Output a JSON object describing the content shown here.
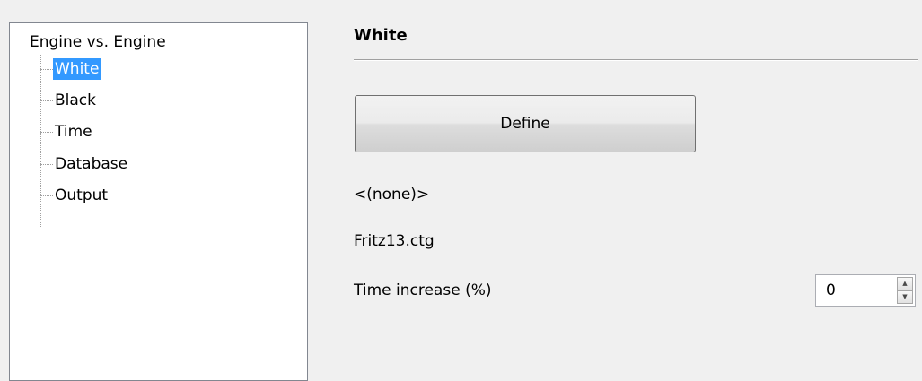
{
  "tree": {
    "root": "Engine vs. Engine",
    "items": [
      {
        "label": "White",
        "selected": true
      },
      {
        "label": "Black"
      },
      {
        "label": "Time"
      },
      {
        "label": "Database"
      },
      {
        "label": "Output"
      }
    ]
  },
  "section": {
    "title": "White"
  },
  "define_button": {
    "label": "Define"
  },
  "engine_text": "<(none)>",
  "book_text": "Fritz13.ctg",
  "time_increase": {
    "label": "Time increase (%)",
    "value": "0"
  },
  "icons": {
    "spin_up": "up-arrow",
    "spin_down": "down-arrow"
  },
  "colors": {
    "selection": "#3399ff",
    "window_bg": "#f0f0f0"
  }
}
